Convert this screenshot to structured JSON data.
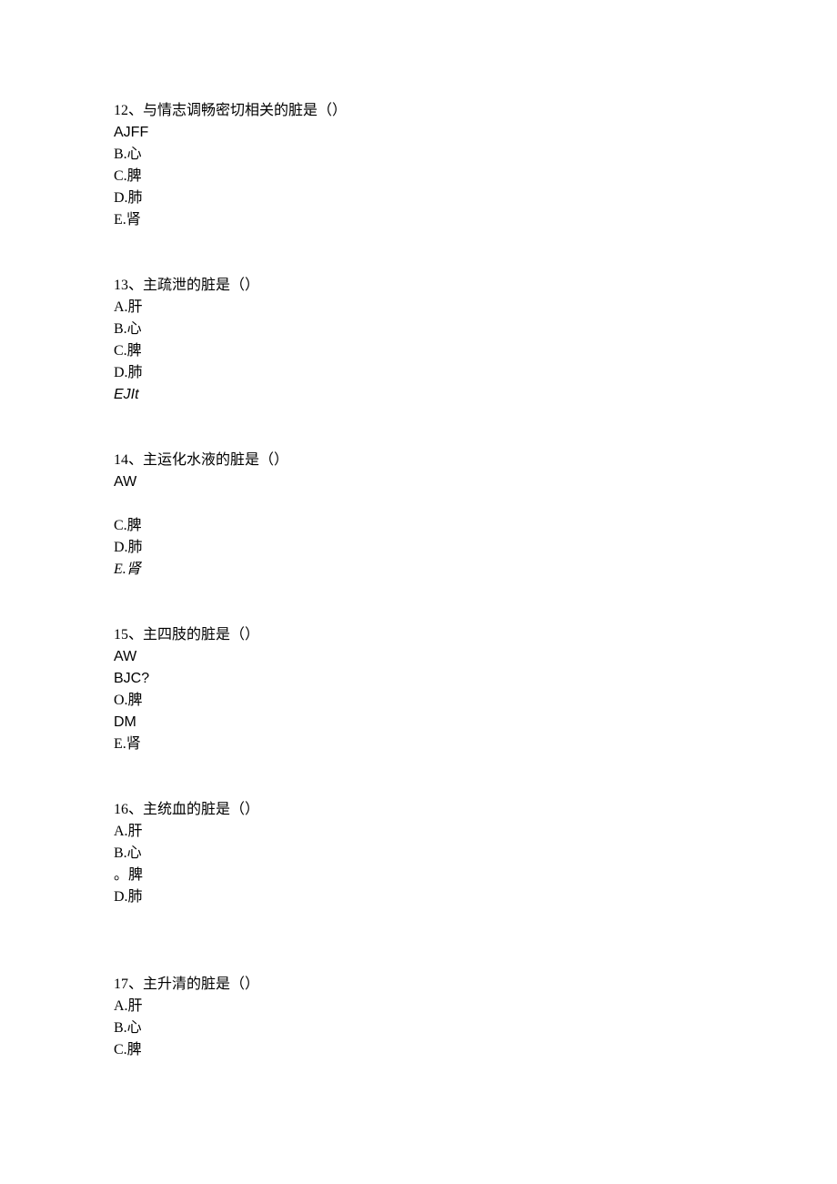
{
  "questions": [
    {
      "stem": "12、与情志调畅密切相关的脏是（）",
      "options": [
        "AJFF",
        "B.心",
        "C.脾",
        "D.肺",
        "E.肾"
      ],
      "optionClasses": [
        "sans",
        "",
        "",
        "",
        ""
      ]
    },
    {
      "stem": "13、主疏泄的脏是（）",
      "options": [
        "A.肝",
        "B.心",
        "C.脾",
        "D.肺",
        "EJIt"
      ],
      "optionClasses": [
        "",
        "",
        "",
        "",
        "italic sans"
      ]
    },
    {
      "stem": "14、主运化水液的脏是（）",
      "options": [
        "AW",
        "",
        "C.脾",
        "D.肺",
        "E.肾"
      ],
      "optionClasses": [
        "sans",
        "",
        "",
        "",
        "italic"
      ]
    },
    {
      "stem": "15、主四肢的脏是（）",
      "options": [
        "AW",
        "BJC?",
        "O.脾",
        "DM",
        "E.肾"
      ],
      "optionClasses": [
        "sans",
        "sans",
        "",
        "sans",
        ""
      ]
    },
    {
      "stem": "16、主统血的脏是（）",
      "options": [
        "A.肝",
        "B.心",
        "。脾",
        "D.肺"
      ],
      "optionClasses": [
        "",
        "",
        "",
        ""
      ]
    },
    {
      "stem": "17、主升清的脏是（）",
      "options": [
        "A.肝",
        "B.心",
        "C.脾"
      ],
      "optionClasses": [
        "",
        "",
        ""
      ]
    }
  ]
}
